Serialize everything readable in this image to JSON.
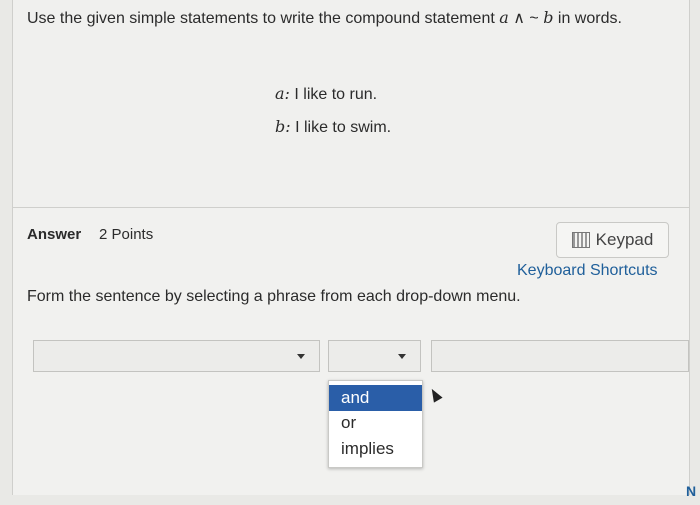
{
  "question": {
    "text_a": "Use the given simple statements to write the compound statement ",
    "var_a": "a",
    "op_and": " ∧ ",
    "op_not": " ~ ",
    "var_b": "b",
    "text_b": " in words."
  },
  "statements": [
    {
      "var": "a:",
      "text": " I like to run."
    },
    {
      "var": "b:",
      "text": " I like to swim."
    }
  ],
  "answer": {
    "label": "Answer",
    "points": "2 Points"
  },
  "keypad": {
    "label": "Keypad"
  },
  "shortcuts": {
    "label": "Keyboard Shortcuts"
  },
  "instruction": "Form the sentence by selecting a phrase from each drop-down menu.",
  "menu": {
    "options": [
      "and",
      "or",
      "implies"
    ],
    "selected": "and"
  },
  "next": {
    "label": "N"
  }
}
